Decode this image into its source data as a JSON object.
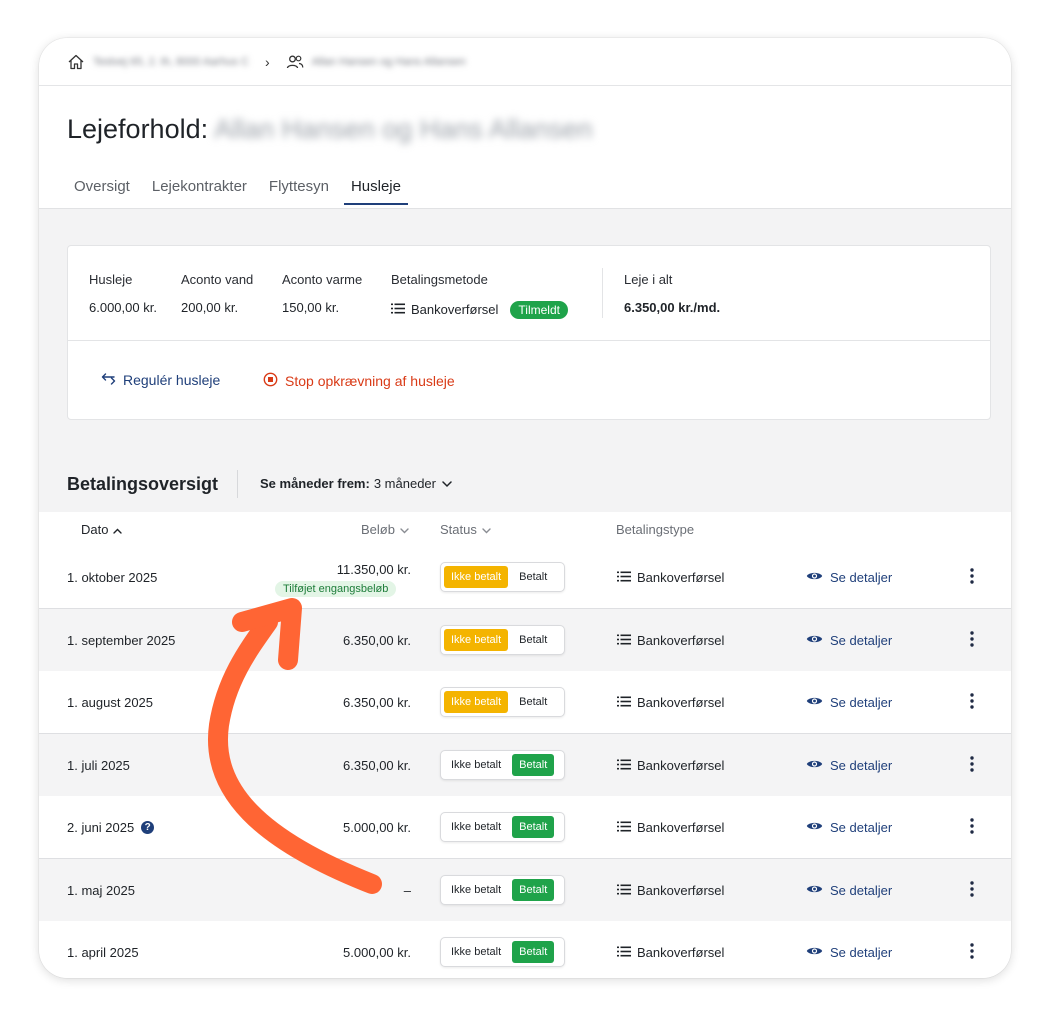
{
  "breadcrumb": {
    "address": "Testvej 65, 2. th, 8000 Aarhus C",
    "tenants": "Allan Hansen og Hans Allansen"
  },
  "header": {
    "title_prefix": "Lejeforhold:",
    "title_name": "Allan Hansen og Hans Allansen"
  },
  "tabs": [
    {
      "label": "Oversigt",
      "active": false
    },
    {
      "label": "Lejekontrakter",
      "active": false
    },
    {
      "label": "Flyttesyn",
      "active": false
    },
    {
      "label": "Husleje",
      "active": true
    }
  ],
  "summary": {
    "husleje": {
      "label": "Husleje",
      "value": "6.000,00 kr."
    },
    "aconto_vand": {
      "label": "Aconto vand",
      "value": "200,00 kr."
    },
    "aconto_varme": {
      "label": "Aconto varme",
      "value": "150,00 kr."
    },
    "betalingsmetode": {
      "label": "Betalingsmetode",
      "value": "Bankoverførsel",
      "badge": "Tilmeldt"
    },
    "leje_i_alt": {
      "label": "Leje i alt",
      "value": "6.350,00 kr./md."
    },
    "actions": {
      "regulate": "Regulér husleje",
      "stop": "Stop opkrævning af husleje"
    }
  },
  "section": {
    "title": "Betalingsoversigt",
    "period_label": "Se måneder frem:",
    "period_value": "3 måneder"
  },
  "table": {
    "columns": {
      "date": "Dato",
      "amount": "Beløb",
      "status": "Status",
      "type": "Betalingstype"
    },
    "status_labels": {
      "unpaid": "Ikke betalt",
      "paid": "Betalt"
    },
    "details_label": "Se detaljer",
    "rows": [
      {
        "date": "1. oktober 2025",
        "amount": "11.350,00 kr.",
        "tag": "Tilføjet engangsbeløb",
        "status": "unpaid",
        "type": "Bankoverførsel"
      },
      {
        "date": "1. september 2025",
        "amount": "6.350,00 kr.",
        "status": "unpaid",
        "type": "Bankoverførsel"
      },
      {
        "date": "1. august 2025",
        "amount": "6.350,00 kr.",
        "status": "unpaid",
        "type": "Bankoverførsel"
      },
      {
        "date": "1. juli 2025",
        "amount": "6.350,00 kr.",
        "status": "paid",
        "type": "Bankoverførsel"
      },
      {
        "date": "2. juni 2025",
        "amount": "5.000,00 kr.",
        "status": "paid",
        "type": "Bankoverførsel",
        "help": true
      },
      {
        "date": "1. maj 2025",
        "amount": "–",
        "status": "paid",
        "type": "Bankoverførsel"
      },
      {
        "date": "1. april 2025",
        "amount": "5.000,00 kr.",
        "status": "paid",
        "type": "Bankoverførsel"
      }
    ]
  },
  "colors": {
    "accent": "#1f3f7a",
    "paid": "#1fa34a",
    "unpaid": "#f4b400",
    "danger": "#d93a16",
    "annotation_arrow": "#ff6534"
  }
}
